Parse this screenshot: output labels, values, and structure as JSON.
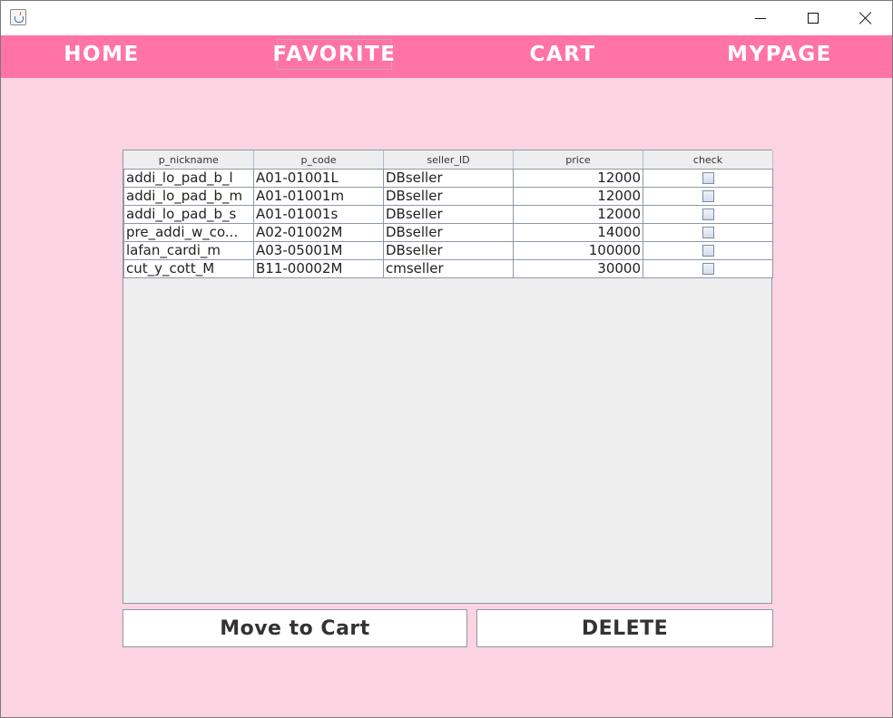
{
  "nav": {
    "home": "HOME",
    "favorite": "FAVORITE",
    "cart": "CART",
    "mypage": "MYPAGE"
  },
  "table": {
    "columns": [
      "p_nickname",
      "p_code",
      "seller_ID",
      "price",
      "check"
    ],
    "rows": [
      {
        "p_nickname": "addi_lo_pad_b_l",
        "p_code": "A01-01001L",
        "seller_ID": "DBseller",
        "price": "12000",
        "checked": false
      },
      {
        "p_nickname": "addi_lo_pad_b_m",
        "p_code": "A01-01001m",
        "seller_ID": "DBseller",
        "price": "12000",
        "checked": false
      },
      {
        "p_nickname": "addi_lo_pad_b_s",
        "p_code": "A01-01001s",
        "seller_ID": "DBseller",
        "price": "12000",
        "checked": false
      },
      {
        "p_nickname": "pre_addi_w_co...",
        "p_code": "A02-01002M",
        "seller_ID": "DBseller",
        "price": "14000",
        "checked": false
      },
      {
        "p_nickname": "lafan_cardi_m",
        "p_code": "A03-05001M",
        "seller_ID": "DBseller",
        "price": "100000",
        "checked": false
      },
      {
        "p_nickname": "cut_y_cott_M",
        "p_code": "B11-00002M",
        "seller_ID": "cmseller",
        "price": "30000",
        "checked": false
      }
    ]
  },
  "buttons": {
    "move_to_cart": "Move to Cart",
    "delete": "DELETE"
  },
  "colors": {
    "nav_bg": "#ff73a5",
    "page_bg": "#fcd3e0"
  },
  "icons": {
    "app": "java-icon",
    "minimize": "minimize-icon",
    "maximize": "maximize-icon",
    "close": "close-icon"
  }
}
